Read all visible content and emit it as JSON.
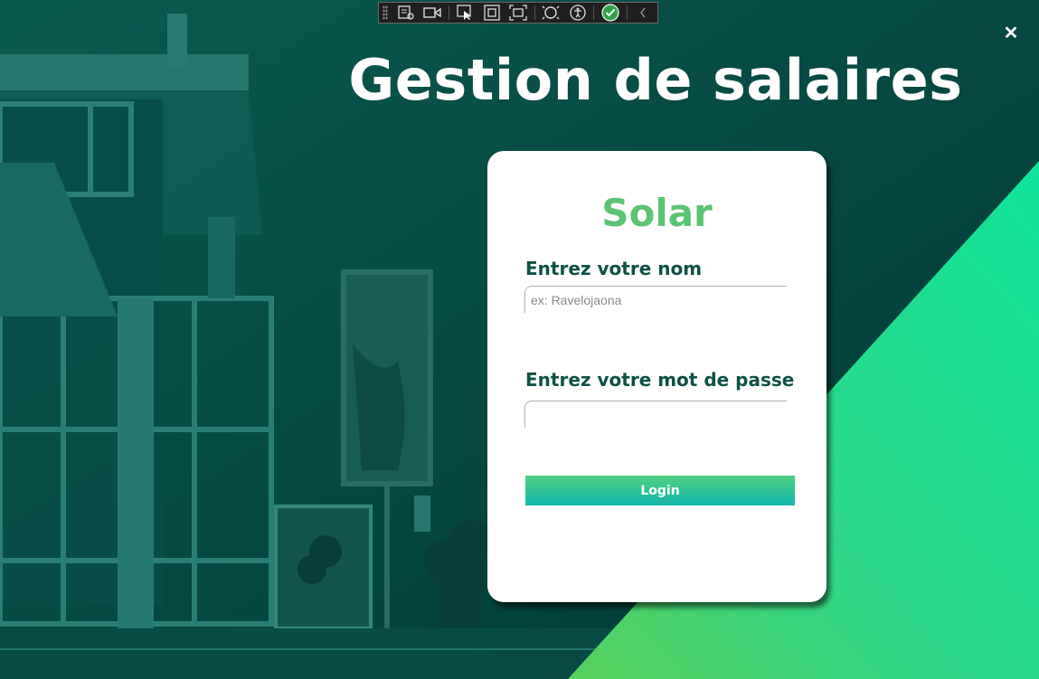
{
  "window": {
    "title": "Gestion de salaires",
    "close_symbol": "✕"
  },
  "toolbar": {
    "icons": [
      "live-visual-tree-icon",
      "video-icon",
      "select-element-icon",
      "display-layout-adorners-icon",
      "track-focus-icon",
      "hot-reload-icon",
      "accessibility-icon",
      "binding-ok-icon",
      "collapse-chevron-icon"
    ]
  },
  "form": {
    "brand": "Solar",
    "name_label": "Entrez votre nom",
    "name_placeholder": "ex: Ravelojaona",
    "password_label": "Entrez votre mot de passe",
    "login_label": "Login"
  },
  "colors": {
    "background_dark": "#033f3c",
    "accent_green": "#5bc472",
    "label_color": "#0e5146",
    "gradient_start": "#14e29a",
    "gradient_end": "#4fd07f"
  }
}
